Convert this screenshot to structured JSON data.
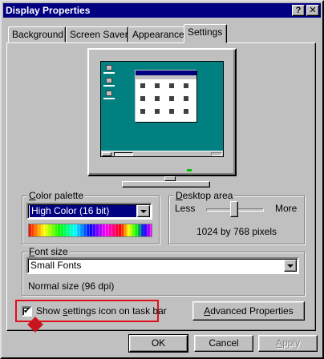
{
  "window": {
    "title": "Display Properties",
    "help_label": "?",
    "close_label": "✕"
  },
  "tabs": [
    {
      "label": "Background",
      "active": false
    },
    {
      "label": "Screen Saver",
      "active": false
    },
    {
      "label": "Appearance",
      "active": false
    },
    {
      "label": "Settings",
      "active": true
    }
  ],
  "color_palette": {
    "label": "Color palette",
    "label_underline": "C",
    "label_rest": "olor palette",
    "selected": "High Color (16 bit)"
  },
  "desktop_area": {
    "label": "Desktop area",
    "label_underline": "D",
    "label_rest": "esktop area",
    "less_label": "Less",
    "more_label": "More",
    "resolution": "1024 by 768 pixels",
    "slider_level": 0.45
  },
  "font_size": {
    "label": "Font size",
    "label_underline": "F",
    "label_rest": "ont size",
    "selected": "Small Fonts",
    "description": "Normal size (96 dpi)"
  },
  "settings_icon": {
    "label_before": "Show ",
    "label_underline": "s",
    "label_after": "ettings icon on task bar",
    "checked": true,
    "check_glyph": "✔"
  },
  "buttons": {
    "advanced_underline": "A",
    "advanced_rest": "dvanced Properties",
    "ok": "OK",
    "cancel": "Cancel",
    "apply_underline": "A",
    "apply_rest": "pply"
  },
  "colors": {
    "title_bar": "#000080",
    "desktop": "#008080",
    "selection": "#000080",
    "highlight_annotation": "#e0101a"
  }
}
